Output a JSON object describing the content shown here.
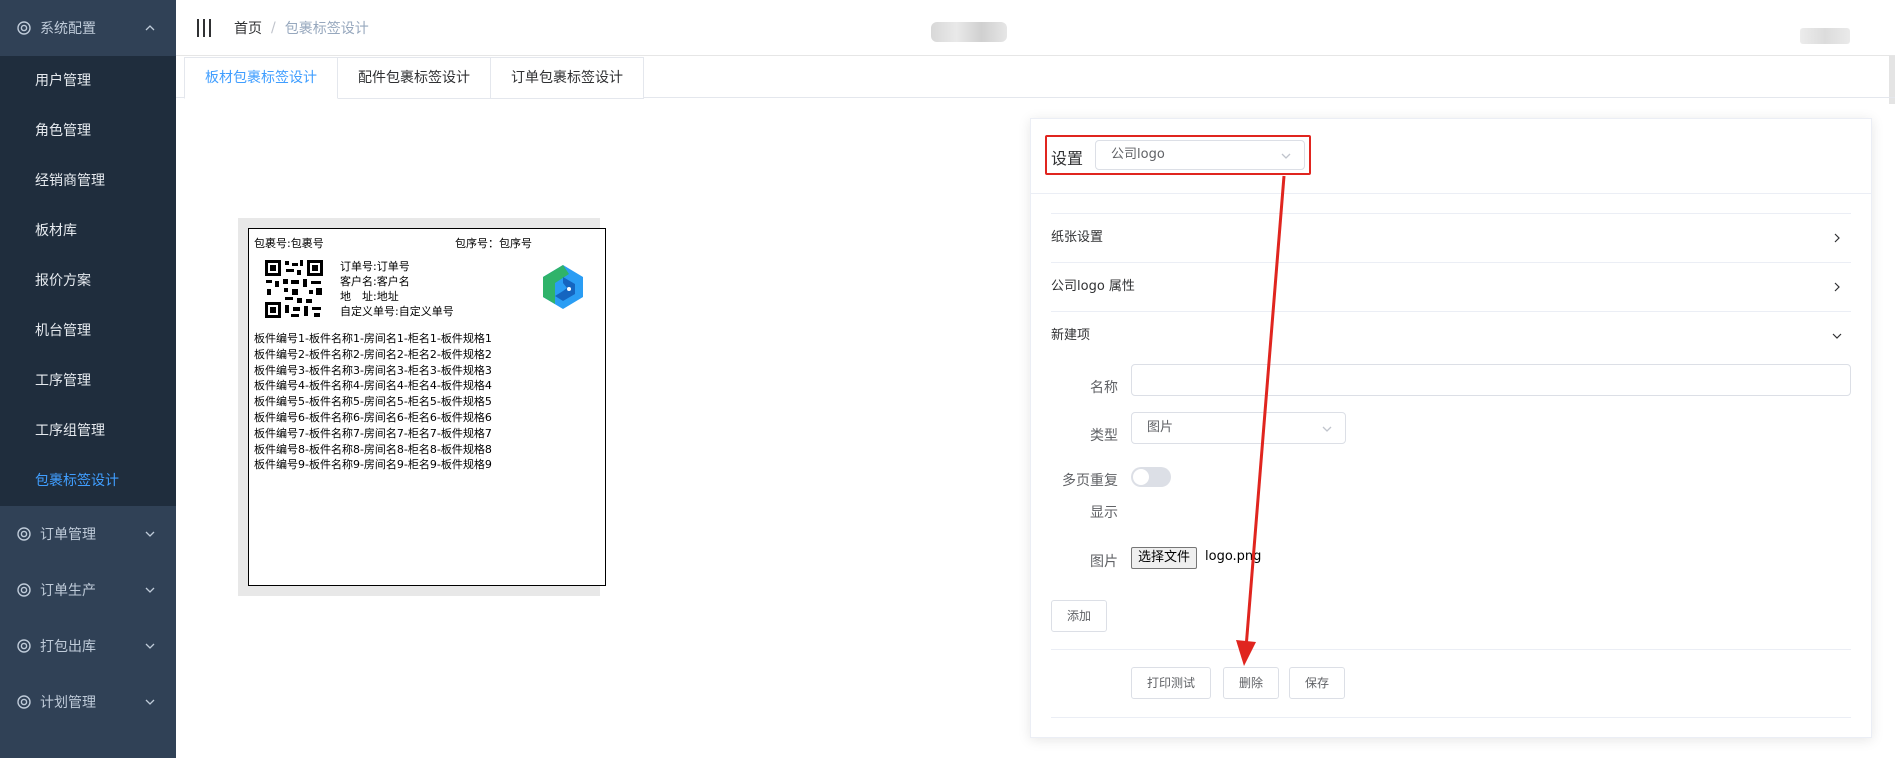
{
  "sidebar": {
    "header": "系统配置",
    "items": [
      "用户管理",
      "角色管理",
      "经销商管理",
      "板材库",
      "报价方案",
      "机台管理",
      "工序管理",
      "工序组管理",
      "包裹标签设计"
    ],
    "active_index": 8,
    "groups": [
      "订单管理",
      "订单生产",
      "打包出库",
      "计划管理"
    ]
  },
  "breadcrumb": {
    "home": "首页",
    "separator": "/",
    "current": "包裹标签设计"
  },
  "tabs": [
    "板材包裹标签设计",
    "配件包裹标签设计",
    "订单包裹标签设计"
  ],
  "label": {
    "package_no": "包裹号:包裹号",
    "sequence_no": "包序号：包序号",
    "info": [
      "订单号:订单号",
      "客户名:客户名",
      "地　址:地址",
      "自定义单号:自定义单号"
    ],
    "rows": [
      "板件编号1-板件名称1-房间名1-柜名1-板件规格1",
      "板件编号2-板件名称2-房间名2-柜名2-板件规格2",
      "板件编号3-板件名称3-房间名3-柜名3-板件规格3",
      "板件编号4-板件名称4-房间名4-柜名4-板件规格4",
      "板件编号5-板件名称5-房间名5-柜名5-板件规格5",
      "板件编号6-板件名称6-房间名6-柜名6-板件规格6",
      "板件编号7-板件名称7-房间名7-柜名7-板件规格7",
      "板件编号8-板件名称8-房间名8-柜名8-板件规格8",
      "板件编号9-板件名称9-房间名9-柜名9-板件规格9"
    ]
  },
  "settings": {
    "title": "设置",
    "selected": "公司logo",
    "sections": [
      "纸张设置",
      "公司logo 属性",
      "新建项"
    ],
    "form": {
      "name_label": "名称",
      "name_value": "",
      "type_label": "类型",
      "type_value": "图片",
      "repeat_label_1": "多页重复",
      "repeat_label_2": "显示",
      "repeat_on": false,
      "image_label": "图片",
      "file_button": "选择文件",
      "file_name": "logo.png",
      "add_button": "添加"
    },
    "actions": [
      "打印测试",
      "删除",
      "保存"
    ]
  },
  "colors": {
    "sidebar_bg": "#304156",
    "submenu_bg": "#1f2d3d",
    "accent": "#409eff",
    "annotation": "#e0251f"
  }
}
